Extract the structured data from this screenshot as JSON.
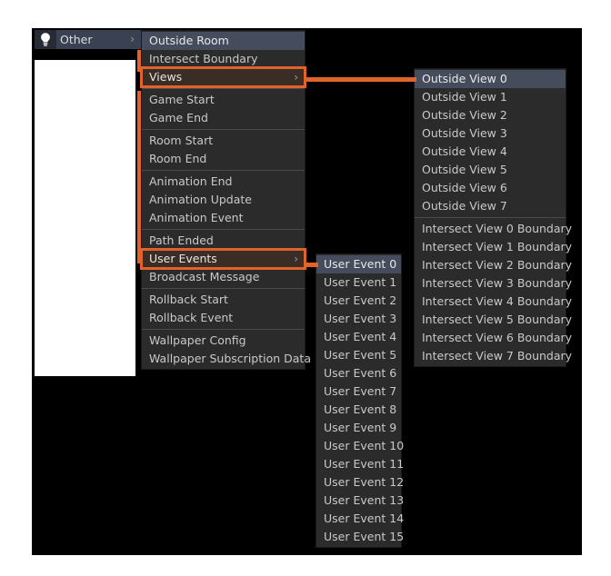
{
  "app": {
    "canvas_background": "#000000",
    "accent_color": "#e2622c",
    "selection_color": "#454d5c",
    "menu_background": "#2b2b2b"
  },
  "root_menu": {
    "icon": "lightbulb-icon",
    "label": "Other",
    "arrow": "›"
  },
  "other_menu": {
    "groups": [
      {
        "items": [
          {
            "label": "Outside Room",
            "selected": true,
            "has_submenu": false
          },
          {
            "label": "Intersect Boundary",
            "selected": false,
            "has_submenu": false
          },
          {
            "label": "Views",
            "selected": false,
            "has_submenu": true,
            "focused": true,
            "arrow": "›"
          }
        ]
      },
      {
        "items": [
          {
            "label": "Game Start",
            "selected": false,
            "has_submenu": false
          },
          {
            "label": "Game End",
            "selected": false,
            "has_submenu": false
          }
        ]
      },
      {
        "items": [
          {
            "label": "Room Start",
            "selected": false,
            "has_submenu": false
          },
          {
            "label": "Room End",
            "selected": false,
            "has_submenu": false
          }
        ]
      },
      {
        "items": [
          {
            "label": "Animation End",
            "selected": false,
            "has_submenu": false
          },
          {
            "label": "Animation Update",
            "selected": false,
            "has_submenu": false
          },
          {
            "label": "Animation Event",
            "selected": false,
            "has_submenu": false
          }
        ]
      },
      {
        "items": [
          {
            "label": "Path Ended",
            "selected": false,
            "has_submenu": false
          },
          {
            "label": "User Events",
            "selected": false,
            "has_submenu": true,
            "focused": true,
            "arrow": "›"
          },
          {
            "label": "Broadcast Message",
            "selected": false,
            "has_submenu": false
          }
        ]
      },
      {
        "items": [
          {
            "label": "Rollback Start",
            "selected": false,
            "has_submenu": false
          },
          {
            "label": "Rollback Event",
            "selected": false,
            "has_submenu": false
          }
        ]
      },
      {
        "items": [
          {
            "label": "Wallpaper Config",
            "selected": false,
            "has_submenu": false
          },
          {
            "label": "Wallpaper Subscription Data",
            "selected": false,
            "has_submenu": false
          }
        ]
      }
    ]
  },
  "user_events_menu": {
    "items": [
      {
        "label": "User Event 0",
        "selected": true
      },
      {
        "label": "User Event 1",
        "selected": false
      },
      {
        "label": "User Event 2",
        "selected": false
      },
      {
        "label": "User Event 3",
        "selected": false
      },
      {
        "label": "User Event 4",
        "selected": false
      },
      {
        "label": "User Event 5",
        "selected": false
      },
      {
        "label": "User Event 6",
        "selected": false
      },
      {
        "label": "User Event 7",
        "selected": false
      },
      {
        "label": "User Event 8",
        "selected": false
      },
      {
        "label": "User Event 9",
        "selected": false
      },
      {
        "label": "User Event 10",
        "selected": false
      },
      {
        "label": "User Event 11",
        "selected": false
      },
      {
        "label": "User Event 12",
        "selected": false
      },
      {
        "label": "User Event 13",
        "selected": false
      },
      {
        "label": "User Event 14",
        "selected": false
      },
      {
        "label": "User Event 15",
        "selected": false
      }
    ]
  },
  "views_menu": {
    "groups": [
      {
        "items": [
          {
            "label": "Outside View 0",
            "selected": true
          },
          {
            "label": "Outside View 1",
            "selected": false
          },
          {
            "label": "Outside View 2",
            "selected": false
          },
          {
            "label": "Outside View 3",
            "selected": false
          },
          {
            "label": "Outside View 4",
            "selected": false
          },
          {
            "label": "Outside View 5",
            "selected": false
          },
          {
            "label": "Outside View 6",
            "selected": false
          },
          {
            "label": "Outside View 7",
            "selected": false
          }
        ]
      },
      {
        "items": [
          {
            "label": "Intersect View 0 Boundary",
            "selected": false
          },
          {
            "label": "Intersect View 1 Boundary",
            "selected": false
          },
          {
            "label": "Intersect View 2 Boundary",
            "selected": false
          },
          {
            "label": "Intersect View 3 Boundary",
            "selected": false
          },
          {
            "label": "Intersect View 4 Boundary",
            "selected": false
          },
          {
            "label": "Intersect View 5 Boundary",
            "selected": false
          },
          {
            "label": "Intersect View 6 Boundary",
            "selected": false
          },
          {
            "label": "Intersect View 7 Boundary",
            "selected": false
          }
        ]
      }
    ]
  }
}
